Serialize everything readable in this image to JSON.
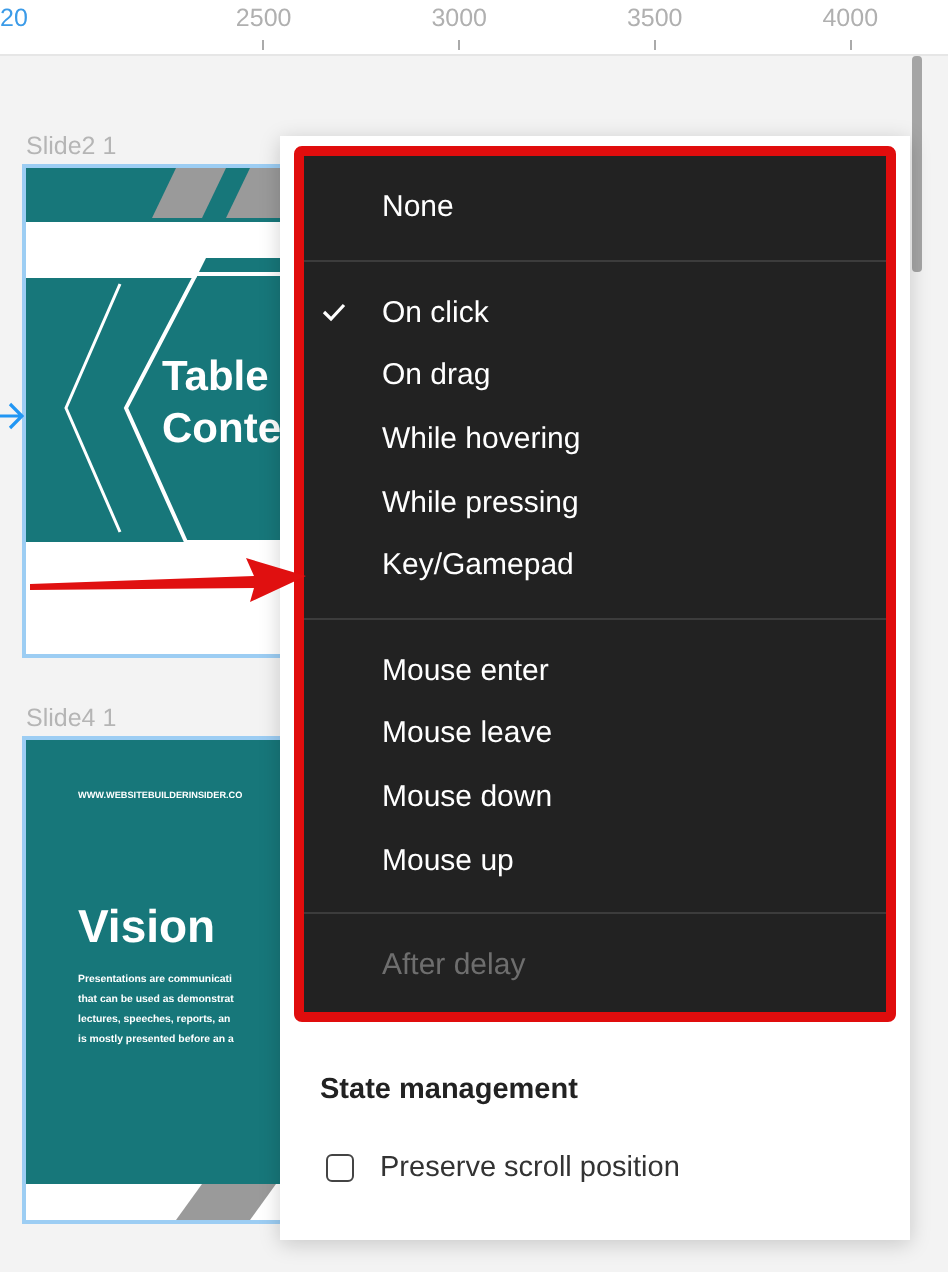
{
  "ruler": {
    "labels": [
      {
        "text": "20",
        "selected": true
      },
      {
        "text": "2500",
        "selected": false
      },
      {
        "text": "3000",
        "selected": false
      },
      {
        "text": "3500",
        "selected": false
      },
      {
        "text": "4000",
        "selected": false
      }
    ]
  },
  "slides": [
    {
      "kind": "contents",
      "name": "Slide2 1",
      "title_lines": [
        "Table",
        "Conte"
      ]
    },
    {
      "kind": "text",
      "name": "Slide4 1",
      "url": "WWW.WEBSITEBUILDERINSIDER.CO",
      "title": "Vision",
      "body_lines": [
        "Presentations are communicati",
        "that can be used as demonstrat",
        "lectures, speeches, reports, an",
        "is mostly presented before an a"
      ]
    }
  ],
  "menu": {
    "groups": [
      [
        {
          "label": "None",
          "checked": false,
          "disabled": false
        }
      ],
      [
        {
          "label": "On click",
          "checked": true,
          "disabled": false
        },
        {
          "label": "On drag",
          "checked": false,
          "disabled": false
        },
        {
          "label": "While hovering",
          "checked": false,
          "disabled": false
        },
        {
          "label": "While pressing",
          "checked": false,
          "disabled": false
        },
        {
          "label": "Key/Gamepad",
          "checked": false,
          "disabled": false
        }
      ],
      [
        {
          "label": "Mouse enter",
          "checked": false,
          "disabled": false
        },
        {
          "label": "Mouse leave",
          "checked": false,
          "disabled": false
        },
        {
          "label": "Mouse down",
          "checked": false,
          "disabled": false
        },
        {
          "label": "Mouse up",
          "checked": false,
          "disabled": false
        }
      ],
      [
        {
          "label": "After delay",
          "checked": false,
          "disabled": true
        }
      ]
    ]
  },
  "state_management": {
    "heading": "State management",
    "options": [
      {
        "label": "Preserve scroll position",
        "checked": false
      }
    ]
  }
}
